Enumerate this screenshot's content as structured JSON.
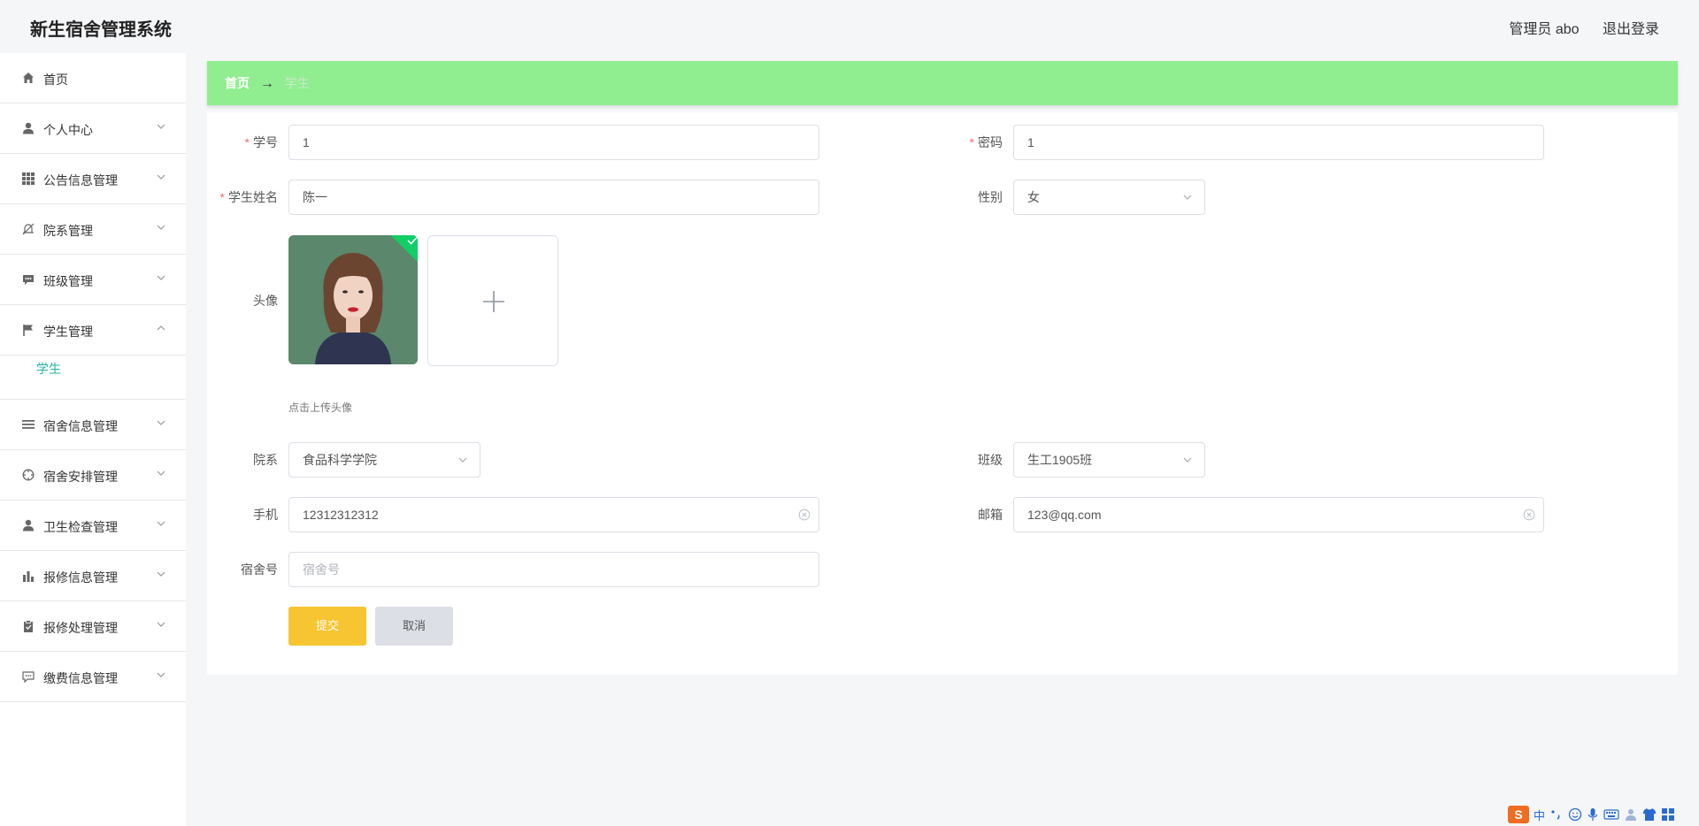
{
  "header": {
    "title": "新生宿舍管理系统",
    "admin_label": "管理员 abo",
    "logout_label": "退出登录"
  },
  "sidebar": {
    "items": [
      {
        "label": "首页",
        "icon": "home-icon"
      },
      {
        "label": "个人中心",
        "icon": "user-icon"
      },
      {
        "label": "公告信息管理",
        "icon": "grid-icon"
      },
      {
        "label": "院系管理",
        "icon": "bell-off-icon"
      },
      {
        "label": "班级管理",
        "icon": "chat-icon"
      },
      {
        "label": "学生管理",
        "icon": "flag-icon"
      },
      {
        "label": "宿舍信息管理",
        "icon": "list-icon"
      },
      {
        "label": "宿舍安排管理",
        "icon": "compass-icon"
      },
      {
        "label": "卫生检查管理",
        "icon": "user-icon"
      },
      {
        "label": "报修信息管理",
        "icon": "bar-chart-icon"
      },
      {
        "label": "报修处理管理",
        "icon": "clipboard-icon"
      },
      {
        "label": "缴费信息管理",
        "icon": "message-icon"
      }
    ],
    "submenu_label": "学生",
    "active_color": "#22b5a0"
  },
  "breadcrumb": {
    "home": "首页",
    "separator": "→",
    "current": "学生"
  },
  "form": {
    "student_id": {
      "label": "学号",
      "value": "1"
    },
    "password": {
      "label": "密码",
      "value": "1"
    },
    "name": {
      "label": "学生姓名",
      "value": "陈一"
    },
    "gender": {
      "label": "性别",
      "value": "女"
    },
    "avatar": {
      "label": "头像",
      "hint": "点击上传头像"
    },
    "department": {
      "label": "院系",
      "value": "食品科学学院"
    },
    "class": {
      "label": "班级",
      "value": "生工1905班"
    },
    "phone": {
      "label": "手机",
      "value": "12312312312"
    },
    "email": {
      "label": "邮箱",
      "value": "123@qq.com"
    },
    "dorm": {
      "label": "宿舍号",
      "value": "",
      "placeholder": "宿舍号"
    },
    "required_mark": "*",
    "submit_label": "提交",
    "cancel_label": "取消"
  },
  "tray": {
    "logo": "S",
    "ime_mode": "中"
  },
  "colors": {
    "breadcrumb_bg": "#90ee90",
    "submit_bg": "#f7c531",
    "cancel_bg": "#dcdfe6",
    "required": "#f56c6c"
  }
}
